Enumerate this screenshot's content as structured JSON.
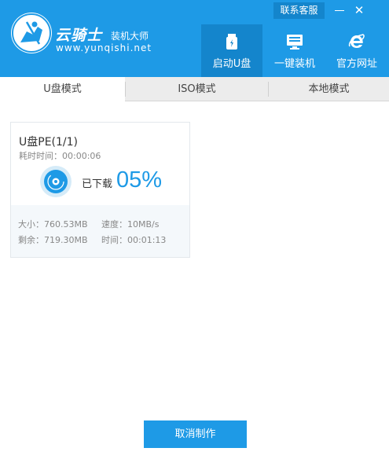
{
  "header": {
    "brand_name": "云骑士",
    "brand_sub": "装机大师",
    "brand_url": "www.yunqishi.net",
    "service_label": "联系客服",
    "minimize_symbol": "—",
    "close_symbol": "✕",
    "nav": [
      {
        "label": "启动U盘",
        "icon": "usb-drive-icon",
        "active": true
      },
      {
        "label": "一键装机",
        "icon": "monitor-icon",
        "active": false
      },
      {
        "label": "官方网址",
        "icon": "ie-browser-icon",
        "active": false
      }
    ]
  },
  "tabs": [
    {
      "label": "U盘模式",
      "active": true
    },
    {
      "label": "ISO模式",
      "active": false
    },
    {
      "label": "本地模式",
      "active": false
    }
  ],
  "task": {
    "title": "U盘PE(1/1)",
    "elapsed": "耗时时间：00:00:06",
    "status_label": "已下载",
    "percent_text": "05%",
    "progress": 0.05,
    "size": "大小：760.53MB",
    "speed": "速度：10MB/s",
    "remaining": "剩余：719.30MB",
    "time": "时间：00:01:13"
  },
  "footer": {
    "cancel_label": "取消制作"
  },
  "colors": {
    "primary": "#1e9ae6",
    "primary_dark": "#1485cc",
    "tab_bar": "#ececec",
    "stats_bg": "#f4f8fb"
  }
}
